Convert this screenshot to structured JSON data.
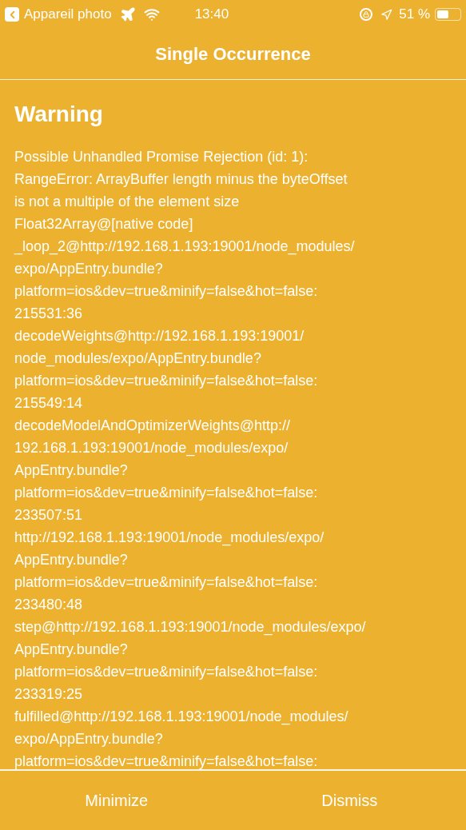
{
  "status_bar": {
    "back_app": "Appareil photo",
    "time": "13:40",
    "battery": "51 %"
  },
  "header": {
    "title": "Single Occurrence"
  },
  "warning": {
    "title": "Warning",
    "lines": [
      "Possible Unhandled Promise Rejection (id: 1):",
      "RangeError: ArrayBuffer length minus the byteOffset",
      "is not a multiple of the element size",
      "Float32Array@[native code]",
      "_loop_2@http://192.168.1.193:19001/node_modules/",
      "expo/AppEntry.bundle?",
      "platform=ios&dev=true&minify=false&hot=false:",
      "215531:36",
      "decodeWeights@http://192.168.1.193:19001/",
      "node_modules/expo/AppEntry.bundle?",
      "platform=ios&dev=true&minify=false&hot=false:",
      "215549:14",
      "decodeModelAndOptimizerWeights@http://",
      "192.168.1.193:19001/node_modules/expo/",
      "AppEntry.bundle?",
      "platform=ios&dev=true&minify=false&hot=false:",
      "233507:51",
      "http://192.168.1.193:19001/node_modules/expo/",
      "AppEntry.bundle?",
      "platform=ios&dev=true&minify=false&hot=false:",
      "233480:48",
      "step@http://192.168.1.193:19001/node_modules/expo/",
      "AppEntry.bundle?",
      "platform=ios&dev=true&minify=false&hot=false:",
      "233319:25",
      "fulfilled@http://192.168.1.193:19001/node_modules/",
      "expo/AppEntry.bundle?",
      "platform=ios&dev=true&minify=false&hot=false:"
    ]
  },
  "buttons": [
    "Minimize",
    "Dismiss"
  ]
}
